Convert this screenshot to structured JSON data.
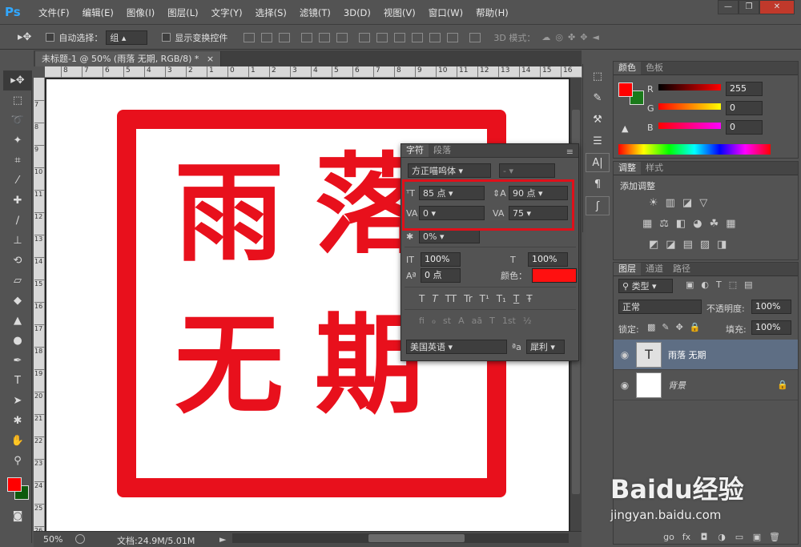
{
  "app": {
    "logo": "Ps"
  },
  "menu": [
    "文件(F)",
    "编辑(E)",
    "图像(I)",
    "图层(L)",
    "文字(Y)",
    "选择(S)",
    "滤镜(T)",
    "3D(D)",
    "视图(V)",
    "窗口(W)",
    "帮助(H)"
  ],
  "window_controls": {
    "minimize": "—",
    "restore": "❐",
    "close": "✕"
  },
  "options": {
    "auto_select_label": "自动选择：",
    "auto_select_value": "组",
    "show_transform_label": "显示变换控件",
    "mode3d_label": "3D 模式："
  },
  "document": {
    "tab_title": "未标题-1 @ 50% (雨落 无期, RGB/8) *",
    "close": "×"
  },
  "canvas": {
    "line1_left": "雨",
    "line1_right": "落",
    "line2_left": "无",
    "line2_right": "期",
    "red": "#e8101c"
  },
  "ruler": {
    "h_ticks": [
      "8",
      "7",
      "6",
      "5",
      "4",
      "3",
      "2",
      "1",
      "0",
      "1",
      "2",
      "3",
      "4",
      "5",
      "6",
      "7",
      "8",
      "9",
      "10",
      "11",
      "12",
      "13",
      "14",
      "15",
      "16",
      "17"
    ],
    "v_ticks": [
      "7",
      "8",
      "9",
      "10",
      "11",
      "12",
      "13",
      "14",
      "15",
      "16",
      "17",
      "18",
      "19",
      "20",
      "21",
      "22",
      "23",
      "24",
      "25",
      "26"
    ]
  },
  "status": {
    "zoom": "50%",
    "doc_info": "文档:24.9M/5.01M"
  },
  "char_panel": {
    "tab_char": "字符",
    "tab_para": "段落",
    "font_family": "方正喵呜体",
    "font_style": "-",
    "font_size": "85 点",
    "leading": "90 点",
    "kerning": "0",
    "tracking": "75",
    "tsume": "0%",
    "vscale": "100%",
    "hscale": "100%",
    "baseline": "0 点",
    "color_label": "颜色：",
    "color": "#ff1010",
    "style_buttons": [
      "T",
      "T",
      "TT",
      "Tr",
      "T¹",
      "T₁",
      "T",
      "Ŧ"
    ],
    "ot_buttons": [
      "fi",
      "ℴ",
      "st",
      "A",
      "aā",
      "T",
      "1st",
      "½"
    ],
    "language": "美国英语",
    "aa_label": "ªa",
    "aa_value": "犀利"
  },
  "color_panel": {
    "tab1": "颜色",
    "tab2": "色板",
    "r_label": "R",
    "g_label": "G",
    "b_label": "B",
    "r": "255",
    "g": "0",
    "b": "0",
    "fg": "#ff0000",
    "bg": "#1a7a1a"
  },
  "adjust_panel": {
    "tab1": "调整",
    "tab2": "样式",
    "title": "添加调整"
  },
  "layers_panel": {
    "tab1": "图层",
    "tab2": "通道",
    "tab3": "路径",
    "filter": "类型",
    "blend": "正常",
    "opacity_label": "不透明度:",
    "opacity": "100%",
    "lock_label": "锁定:",
    "fill_label": "填充:",
    "fill": "100%",
    "layers": [
      {
        "name": "雨落 无期",
        "thumb": "T"
      },
      {
        "name": "背景",
        "thumb": ""
      }
    ],
    "bottom_icons": [
      "go",
      "fx",
      "◘",
      "◑",
      "▭",
      "▣",
      "🗑"
    ]
  },
  "watermark": {
    "text": "Baidu经验",
    "url": "jingyan.baidu.com"
  }
}
